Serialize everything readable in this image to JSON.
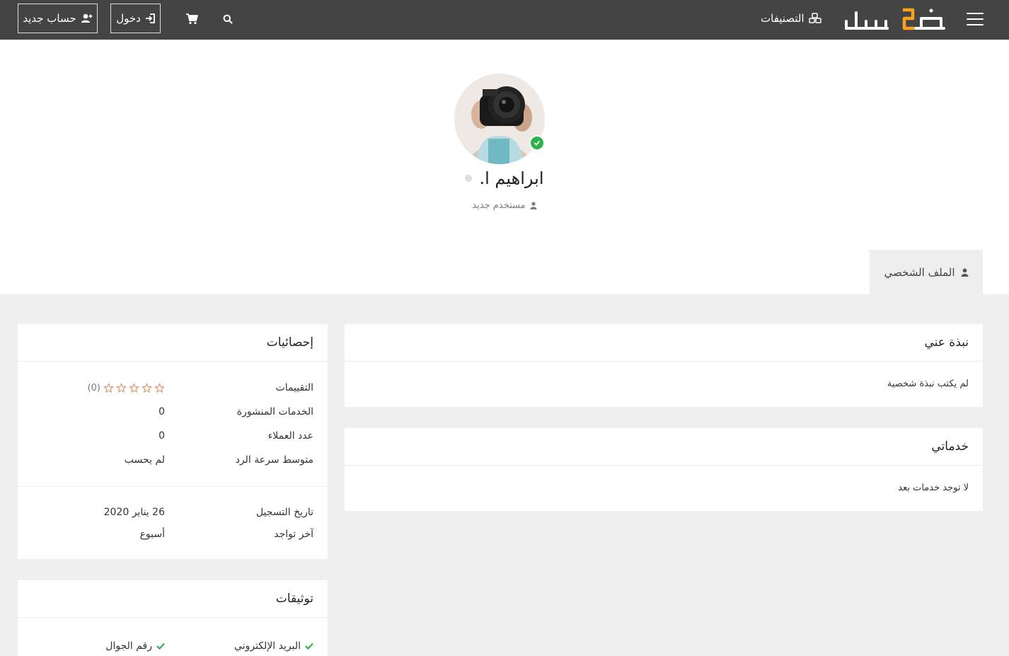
{
  "header": {
    "logo_text": "خمسات",
    "categories_label": "التصنيفات",
    "login_label": "دخول",
    "signup_label": "حساب جديد"
  },
  "profile": {
    "name": "ابراهيم ا.",
    "role": "مستخدم جديد",
    "tab_label": "الملف الشخصي"
  },
  "about": {
    "title": "نبذة عني",
    "text": "لم يكتب نبذة شخصية"
  },
  "services": {
    "title": "خدماتي",
    "text": "لا توجد خدمات بعد"
  },
  "stats": {
    "title": "إحصائيات",
    "rows": [
      {
        "label": "التقييمات",
        "value": "(0)"
      },
      {
        "label": "الخدمات المنشورة",
        "value": "0"
      },
      {
        "label": "عدد العملاء",
        "value": "0"
      },
      {
        "label": "متوسط سرعة الرد",
        "value": "لم يحسب"
      }
    ],
    "rows2": [
      {
        "label": "تاريخ التسجيل",
        "value": "26 يناير 2020"
      },
      {
        "label": "آخر تواجد",
        "value": "أسبوع"
      }
    ],
    "rating_stars": 0
  },
  "verifications": {
    "title": "توثيقات",
    "items": [
      {
        "label": "البريد الإلكتروني"
      },
      {
        "label": "رقم الجوال"
      }
    ]
  },
  "colors": {
    "topbar": "#444444",
    "accent": "#f9a21b",
    "verified_green": "#2bb24a",
    "star_outline": "#e08a5a",
    "background": "#efefef"
  }
}
